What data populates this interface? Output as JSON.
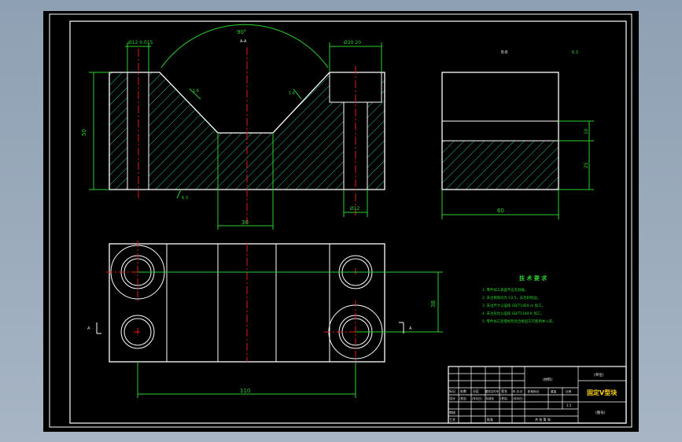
{
  "viewport": {
    "background": "#9aabbd",
    "sheet": "#000000"
  },
  "colors": {
    "outline": "#ffffff",
    "section": "#27d3a8",
    "dimension": "#2cd12c",
    "center": "#e01a1a",
    "title": "#ffd21f",
    "text": "#f2f2f2"
  },
  "dims": {
    "angle": "90°",
    "view_a": "A-A",
    "bore_left": "Ø12 0.015",
    "counterbore": "Ø20 20",
    "height": "50",
    "slot_width": "30",
    "hole_bottom": "Ø12",
    "roughness_left": "1.6",
    "roughness_right": "1.6",
    "roughness_base": "6.3",
    "roughness_general": "6.3",
    "side_view": "B-B",
    "side_h1": "10",
    "side_h2": "25",
    "side_width": "60",
    "plan_height": "38",
    "plan_width": "110",
    "mark_a_left": "A",
    "mark_a_right": "A"
  },
  "notes": {
    "title": "技 术 要 求",
    "items": [
      "1. 零件加工表面不应有划痕。",
      "2. 未注倒角均为 C0.5，去毛刺锐边。",
      "3. 未注尺寸公差按 GB/T1804-m 加工。",
      "4. 未注形位公差按 GB/T1184-K 加工。",
      "5. 零件加工后需经检验合格后方可使用并入库。"
    ]
  },
  "title_block": {
    "material": "(材料)",
    "part_name": "固定V型块",
    "drawing_no": "(图号)",
    "org": "(单位)",
    "mark_row": [
      "标记",
      "处数",
      "分区",
      "更改文件号",
      "签名",
      "年.月.日"
    ],
    "design_row": [
      "设计",
      "(签名)",
      "(年月日)",
      "标准化",
      "(签名)",
      "(年月日)"
    ],
    "check_row": [
      "审核",
      "",
      "",
      "",
      "",
      ""
    ],
    "craft_row": [
      "工艺",
      "",
      "批准",
      "",
      "",
      ""
    ],
    "stage_labels": [
      "阶段标记",
      "重量",
      "比例"
    ],
    "scale": "1:1",
    "sheet_info": "共 张 第 张"
  }
}
